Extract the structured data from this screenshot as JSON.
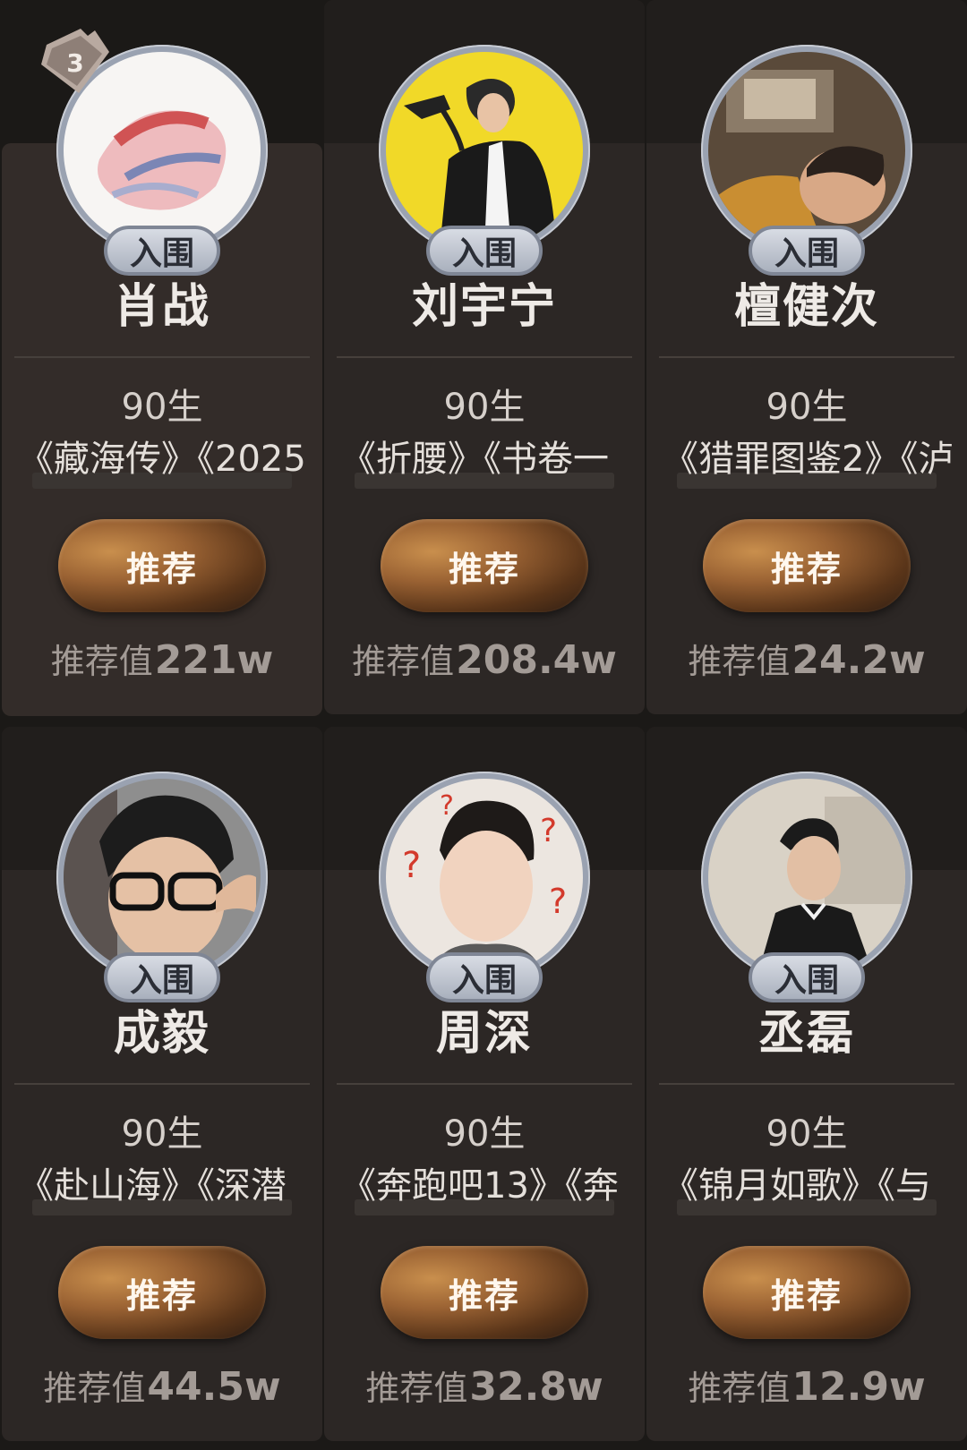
{
  "cards": [
    {
      "name": "肖战",
      "badge": "入围",
      "birth": "90生",
      "works": "《藏海传》《2025",
      "button": "推荐",
      "value_label": "推荐值",
      "value": "221w",
      "rank": "3"
    },
    {
      "name": "刘宇宁",
      "badge": "入围",
      "birth": "90生",
      "works": "《折腰》《书卷一",
      "button": "推荐",
      "value_label": "推荐值",
      "value": "208.4w"
    },
    {
      "name": "檀健次",
      "badge": "入围",
      "birth": "90生",
      "works": "《猎罪图鉴2》《泸",
      "button": "推荐",
      "value_label": "推荐值",
      "value": "24.2w"
    },
    {
      "name": "成毅",
      "badge": "入围",
      "birth": "90生",
      "works": "《赴山海》《深潜",
      "button": "推荐",
      "value_label": "推荐值",
      "value": "44.5w"
    },
    {
      "name": "周深",
      "badge": "入围",
      "birth": "90生",
      "works": "《奔跑吧13》《奔",
      "button": "推荐",
      "value_label": "推荐值",
      "value": "32.8w"
    },
    {
      "name": "丞磊",
      "badge": "入围",
      "birth": "90生",
      "works": "《锦月如歌》《与",
      "button": "推荐",
      "value_label": "推荐值",
      "value": "12.9w"
    }
  ],
  "colors": {
    "background": "#1b1917",
    "card": "#2c2725",
    "button_gold": "#c98f4d",
    "badge_silver": "#c8ccd4"
  },
  "icons": {
    "rank_tag": "rank-badge-icon"
  }
}
